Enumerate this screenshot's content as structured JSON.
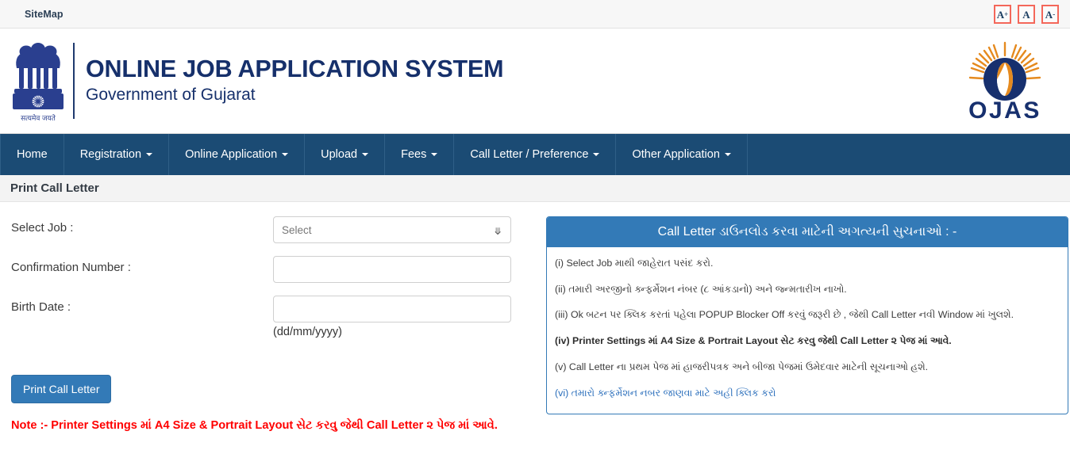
{
  "topbar": {
    "sitemap_label": "SiteMap",
    "font_buttons": [
      {
        "name": "increase",
        "letter": "A",
        "mark": "+"
      },
      {
        "name": "normal",
        "letter": "A",
        "mark": ""
      },
      {
        "name": "decrease",
        "letter": "A",
        "mark": "-"
      }
    ],
    "accent_border": "#f4675a"
  },
  "masthead": {
    "title": "ONLINE JOB APPLICATION SYSTEM",
    "subtitle": "Government of Gujarat",
    "emblem_motto": "सत्यमेव जयते",
    "emblem_icon": "india-state-emblem",
    "logo_text": "OJAS",
    "logo_icon": "ojas-sunburst-logo",
    "title_color": "#16306b",
    "logo_navy": "#1b3a7a",
    "logo_orange": "#e58a1f"
  },
  "nav": {
    "background": "#1b4b74",
    "items": [
      {
        "label": "Home",
        "caret": false
      },
      {
        "label": "Registration",
        "caret": true
      },
      {
        "label": "Online Application",
        "caret": true
      },
      {
        "label": "Upload",
        "caret": true
      },
      {
        "label": "Fees",
        "caret": true
      },
      {
        "label": "Call Letter / Preference",
        "caret": true
      },
      {
        "label": "Other Application",
        "caret": true
      }
    ]
  },
  "page": {
    "title": "Print Call Letter"
  },
  "form": {
    "job_label": "Select Job :",
    "job_value": "Select",
    "job_options": [
      "Select"
    ],
    "confirmation_label": "Confirmation Number :",
    "confirmation_value": "",
    "confirmation_placeholder": "",
    "birthdate_label": "Birth Date :",
    "birthdate_value": "",
    "birthdate_placeholder": "",
    "birthdate_hint": "(dd/mm/yyyy)",
    "submit_label": "Print Call Letter",
    "submit_color": "#337ab7",
    "note": "Note :- Printer Settings માં A4 Size & Portrait Layout સેટ કરવુ જેથી Call Letter ૨ પેજ માં આવે.",
    "note_color": "#ff0000"
  },
  "instructions": {
    "header": "Call Letter ડાઉનલોડ કરવા માટેની અગત્યની સુચનાઓ : -",
    "header_color": "#337ab7",
    "items": [
      {
        "text": "(i) Select Job માથી જાહેરાત પસંદ કરો.",
        "style": "normal"
      },
      {
        "text": "(ii) તમારી અરજીનો ક્ન્ફર્મેશન નંબર (૮ આંકડાનો) અને જ્ન્મતારીખ નાખો.",
        "style": "normal"
      },
      {
        "text": "(iii) Ok બટન પર ક્લિક કરતાં પહેલા POPUP Blocker Off કરવું જરૂરી છે , જેથી Call Letter નવી Window માં ખુલશે.",
        "style": "normal"
      },
      {
        "text": "(iv) Printer Settings માં A4 Size & Portrait Layout સેટ કરવુ જેથી Call Letter ૨ પેજ માં આવે.",
        "style": "bold"
      },
      {
        "text": "(v) Call Letter ના પ્રથમ પેજ માં હાજરીપત્રક અને બીજા પેજમાં ઉમેદવાર માટેની સૂચનાઓ હશે.",
        "style": "normal"
      },
      {
        "text": "(vi) તમારો ક્ન્ફર્મેશન નબર જાણવા માટે અહી ક્લિક કરો",
        "style": "link"
      }
    ]
  }
}
